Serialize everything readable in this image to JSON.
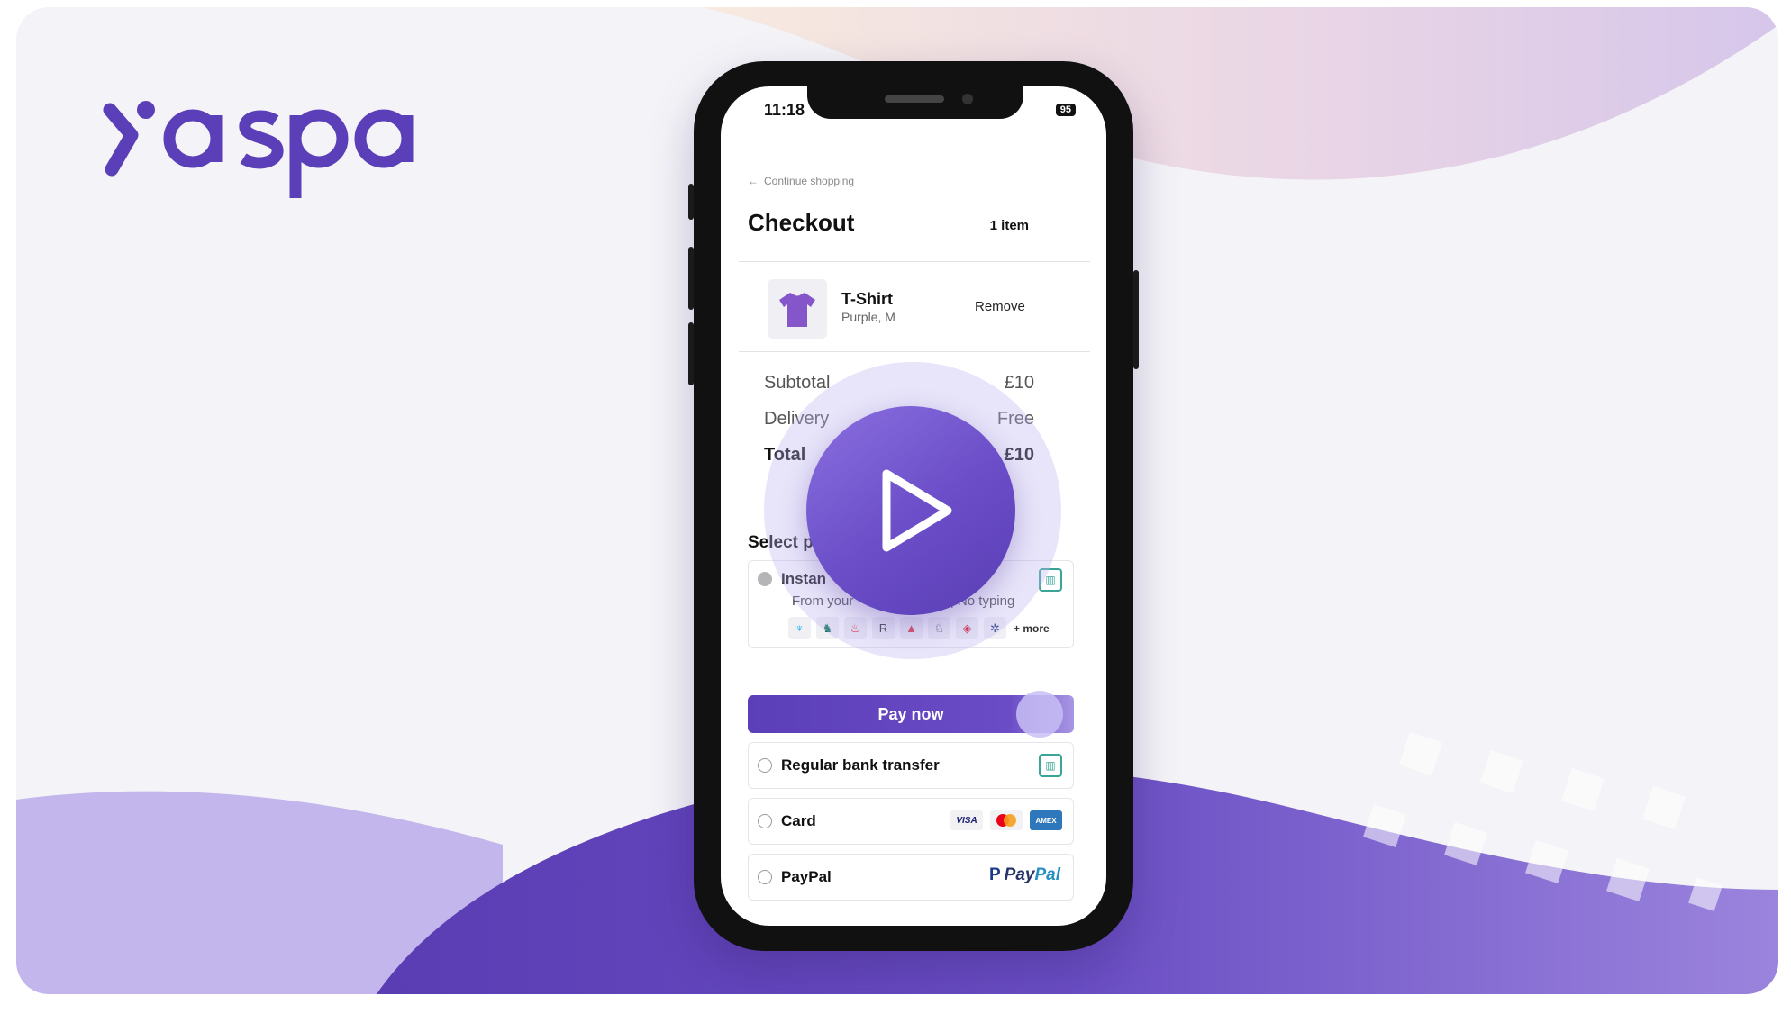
{
  "brand": {
    "logo_text": "yaspa",
    "color": "#5b3fb8"
  },
  "phone": {
    "time": "11:18",
    "battery": "95"
  },
  "checkout": {
    "continue_label": "Continue shopping",
    "title": "Checkout",
    "item_count": "1 item",
    "product": {
      "name": "T-Shirt",
      "variant": "Purple, M",
      "remove_label": "Remove"
    },
    "summary": {
      "subtotal_label": "Subtotal",
      "subtotal_value": "£10",
      "delivery_label": "Delivery",
      "delivery_value": "Free",
      "total_label": "Total",
      "total_value": "£10"
    },
    "select_label": "Select p",
    "options": {
      "instant": {
        "label": "Instan",
        "sub_left": "From your",
        "sub_right": "app | No typing",
        "more": "+ more"
      },
      "pay_now": "Pay now",
      "regular": {
        "label": "Regular bank transfer"
      },
      "card": {
        "label": "Card",
        "visa": "VISA",
        "amex": "AMEX"
      },
      "paypal": {
        "label": "PayPal",
        "logo_pay": "Pay",
        "logo_pal": "Pal"
      }
    }
  },
  "icons": {
    "play": "play-icon",
    "arrow_left": "arrow-left-icon",
    "tshirt": "tshirt-icon",
    "bank": "bank-icon"
  },
  "colors": {
    "accent": "#5b3fb8",
    "play_start": "#8a6fe0",
    "play_end": "#5a3eb5",
    "bank_icon": "#3aa597"
  }
}
